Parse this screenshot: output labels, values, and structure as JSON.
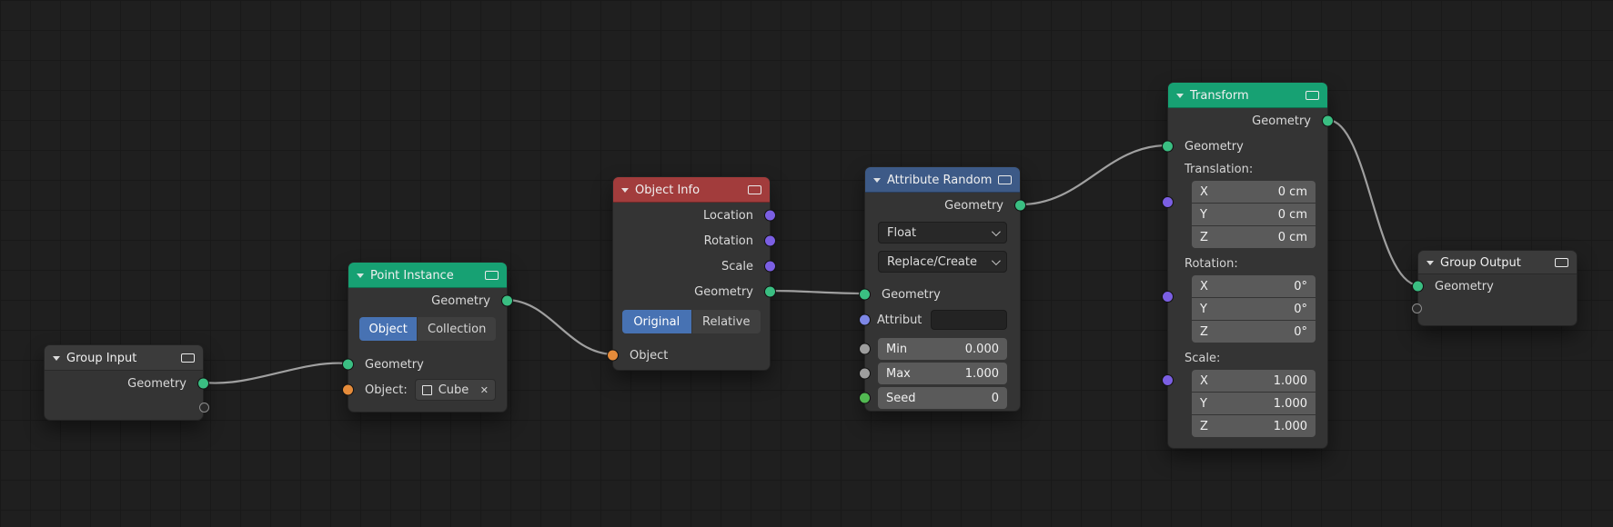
{
  "colors": {
    "header_geometry": "#17a173",
    "header_input": "#a23c3c",
    "header_attribute": "#3d5a87",
    "header_group": "#3b3b3b",
    "socket_geometry": "#3abe82",
    "socket_object": "#e58b3a",
    "socket_vector": "#7b5fe3",
    "socket_attribute": "#7d87e6",
    "socket_float": "#9e9e9e",
    "socket_int": "#52b952",
    "selected_button": "#4772b3",
    "wire": "#a0a0a0"
  },
  "nodes": {
    "group_input": {
      "title": "Group Input",
      "geometry_out": "Geometry"
    },
    "point_instance": {
      "title": "Point Instance",
      "geometry_out": "Geometry",
      "btn_object": "Object",
      "btn_collection": "Collection",
      "geometry_in": "Geometry",
      "object_label": "Object:",
      "object_value": "Cube",
      "clear_icon": "✕"
    },
    "object_info": {
      "title": "Object Info",
      "out_location": "Location",
      "out_rotation": "Rotation",
      "out_scale": "Scale",
      "out_geometry": "Geometry",
      "btn_original": "Original",
      "btn_relative": "Relative",
      "in_object": "Object"
    },
    "attribute_randomize": {
      "title": "Attribute Randomi..",
      "geometry_out": "Geometry",
      "data_type": "Float",
      "mode": "Replace/Create",
      "geometry_in": "Geometry",
      "attribute_label": "Attribut",
      "min_label": "Min",
      "min_value": "0.000",
      "max_label": "Max",
      "max_value": "1.000",
      "seed_label": "Seed",
      "seed_value": "0"
    },
    "transform": {
      "title": "Transform",
      "geometry_out": "Geometry",
      "geometry_in": "Geometry",
      "translation_label": "Translation:",
      "rotation_label": "Rotation:",
      "scale_label": "Scale:",
      "translation": [
        {
          "axis": "X",
          "value": "0 cm"
        },
        {
          "axis": "Y",
          "value": "0 cm"
        },
        {
          "axis": "Z",
          "value": "0 cm"
        }
      ],
      "rotation": [
        {
          "axis": "X",
          "value": "0°"
        },
        {
          "axis": "Y",
          "value": "0°"
        },
        {
          "axis": "Z",
          "value": "0°"
        }
      ],
      "scale": [
        {
          "axis": "X",
          "value": "1.000"
        },
        {
          "axis": "Y",
          "value": "1.000"
        },
        {
          "axis": "Z",
          "value": "1.000"
        }
      ]
    },
    "group_output": {
      "title": "Group Output",
      "geometry_in": "Geometry"
    }
  }
}
